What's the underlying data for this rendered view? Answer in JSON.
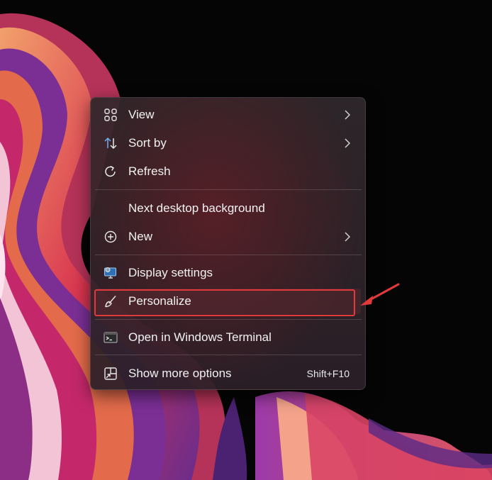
{
  "context_menu": {
    "items": [
      {
        "label": "View",
        "icon": "grid-icon",
        "submenu": true
      },
      {
        "label": "Sort by",
        "icon": "sort-icon",
        "submenu": true
      },
      {
        "label": "Refresh",
        "icon": "refresh-icon",
        "submenu": false
      },
      {
        "label": "Next desktop background",
        "icon": "",
        "submenu": false
      },
      {
        "label": "New",
        "icon": "plus-circle-icon",
        "submenu": true
      },
      {
        "label": "Display settings",
        "icon": "display-settings-icon",
        "submenu": false
      },
      {
        "label": "Personalize",
        "icon": "brush-icon",
        "submenu": false,
        "highlighted": true
      },
      {
        "label": "Open in Windows Terminal",
        "icon": "terminal-icon",
        "submenu": false
      },
      {
        "label": "Show more options",
        "icon": "more-options-icon",
        "submenu": false,
        "shortcut": "Shift+F10"
      }
    ]
  },
  "annotation": {
    "color": "#e23a3a"
  }
}
